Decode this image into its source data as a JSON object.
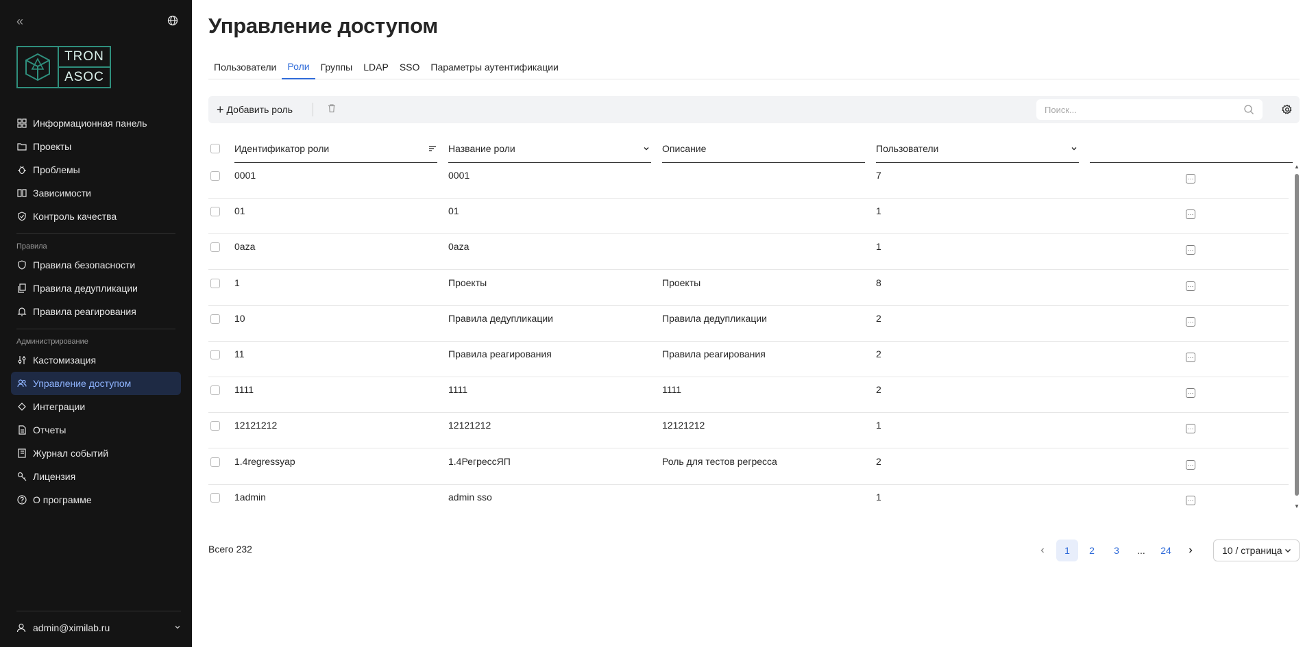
{
  "sidebar": {
    "logo": {
      "line1": "TRON",
      "line2": "ASOC"
    },
    "nav_main": [
      {
        "label": "Информационная панель",
        "icon": "dashboard-icon"
      },
      {
        "label": "Проекты",
        "icon": "folder-icon"
      },
      {
        "label": "Проблемы",
        "icon": "bug-icon"
      },
      {
        "label": "Зависимости",
        "icon": "book-icon"
      },
      {
        "label": "Контроль качества",
        "icon": "shield-check-icon"
      }
    ],
    "section_rules": "Правила",
    "nav_rules": [
      {
        "label": "Правила безопасности",
        "icon": "shield-icon"
      },
      {
        "label": "Правила дедупликации",
        "icon": "copy-icon"
      },
      {
        "label": "Правила реагирования",
        "icon": "bell-icon"
      }
    ],
    "section_admin": "Администрирование",
    "nav_admin": [
      {
        "label": "Кастомизация",
        "icon": "sliders-icon"
      },
      {
        "label": "Управление доступом",
        "icon": "users-icon"
      },
      {
        "label": "Интеграции",
        "icon": "integration-icon"
      },
      {
        "label": "Отчеты",
        "icon": "report-icon"
      },
      {
        "label": "Журнал событий",
        "icon": "journal-icon"
      },
      {
        "label": "Лицензия",
        "icon": "key-icon"
      },
      {
        "label": "О программе",
        "icon": "help-icon"
      }
    ],
    "active_item": "Управление доступом",
    "user": "admin@ximilab.ru"
  },
  "main": {
    "title": "Управление доступом",
    "tabs": [
      {
        "label": "Пользователи"
      },
      {
        "label": "Роли"
      },
      {
        "label": "Группы"
      },
      {
        "label": "LDAP"
      },
      {
        "label": "SSO"
      },
      {
        "label": "Параметры аутентификации"
      }
    ],
    "active_tab": "Роли",
    "toolbar": {
      "add_label": "Добавить роль",
      "search_placeholder": "Поиск..."
    },
    "columns": {
      "id": "Идентификатор роли",
      "name": "Название роли",
      "description": "Описание",
      "users": "Пользователи"
    },
    "rows": [
      {
        "id": "0001",
        "name": "0001",
        "description": "",
        "users": "7"
      },
      {
        "id": "01",
        "name": "01",
        "description": "",
        "users": "1"
      },
      {
        "id": "0aza",
        "name": "0aza",
        "description": "",
        "users": "1"
      },
      {
        "id": "1",
        "name": "Проекты",
        "description": "Проекты",
        "users": "8"
      },
      {
        "id": "10",
        "name": "Правила дедупликации",
        "description": "Правила дедупликации",
        "users": "2"
      },
      {
        "id": "11",
        "name": "Правила реагирования",
        "description": "Правила реагирования",
        "users": "2"
      },
      {
        "id": "1111",
        "name": "1111",
        "description": "1111",
        "users": "2"
      },
      {
        "id": "12121212",
        "name": "12121212",
        "description": "12121212",
        "users": "1"
      },
      {
        "id": "1.4regressyap",
        "name": "1.4РегрессЯП",
        "description": "Роль для тестов регресса",
        "users": "2"
      },
      {
        "id": "1admin",
        "name": "admin sso",
        "description": "",
        "users": "1"
      }
    ],
    "total": "Всего 232",
    "pagination": {
      "pages": [
        "1",
        "2",
        "3",
        "...",
        "24"
      ],
      "current": "1",
      "page_size": "10 / страница"
    }
  }
}
